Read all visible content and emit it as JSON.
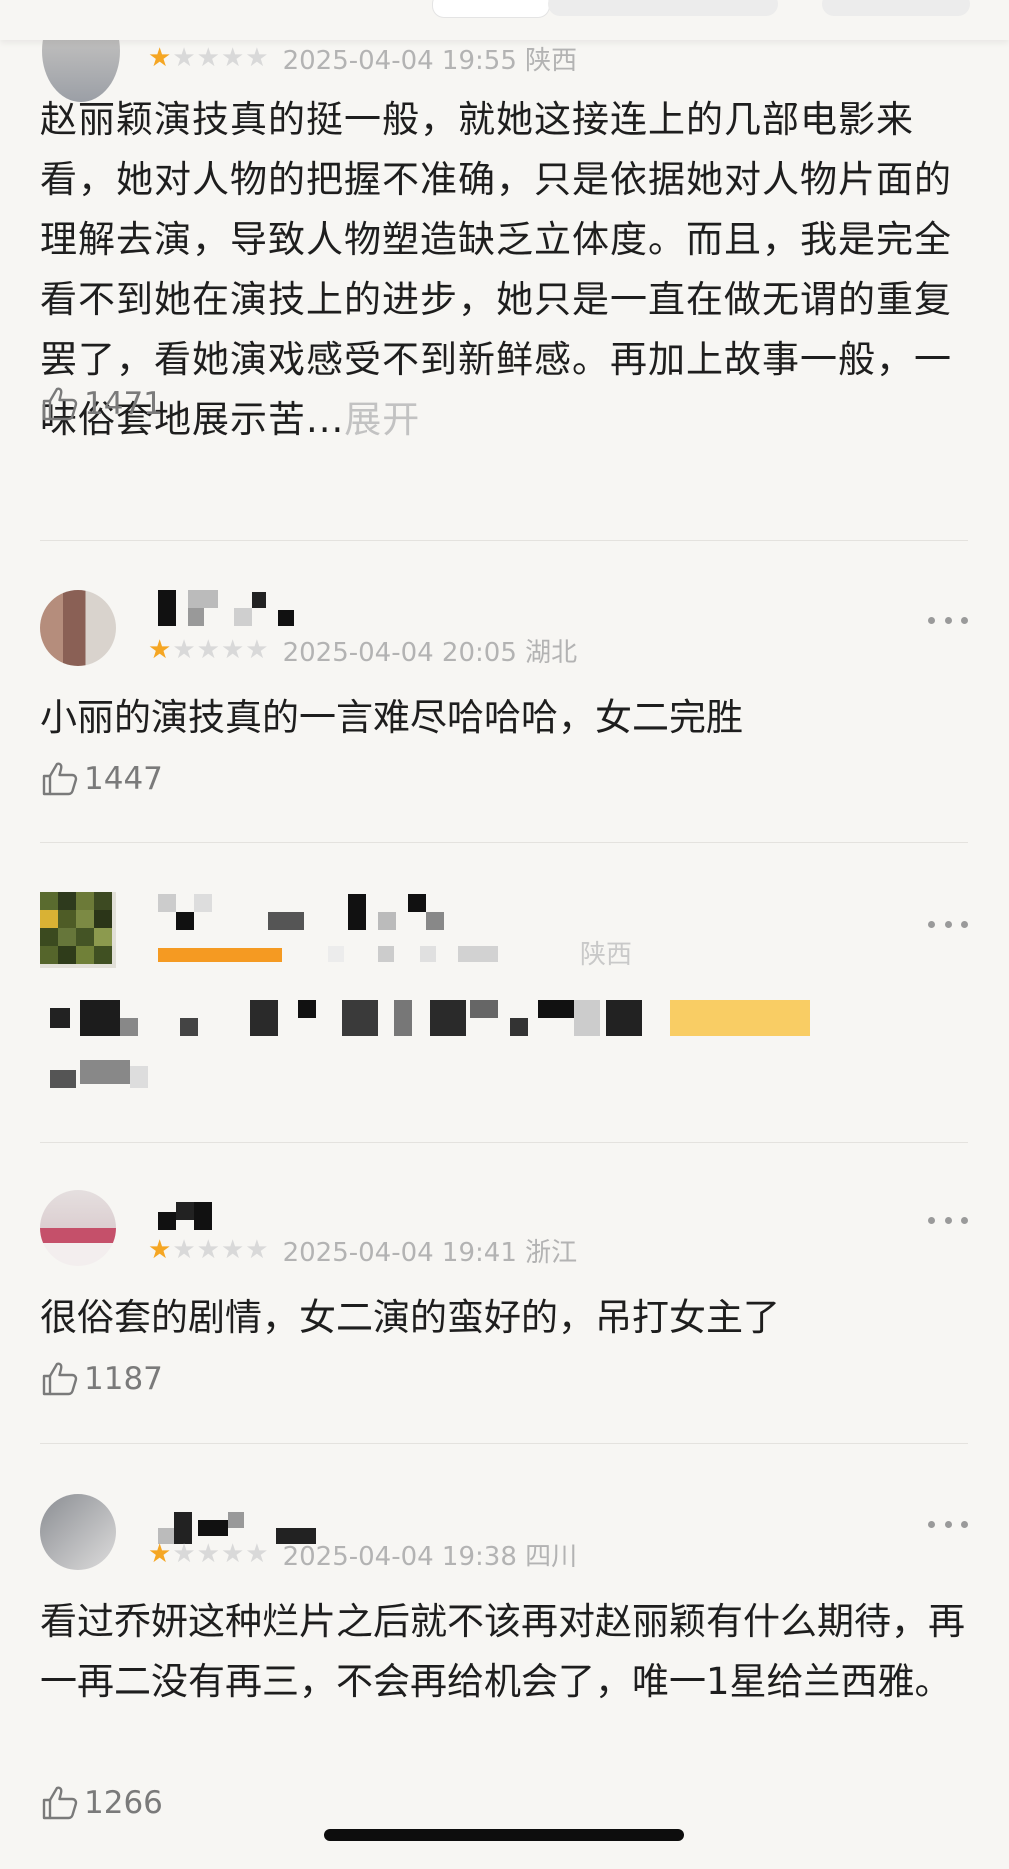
{
  "colors": {
    "accent_star": "#f5a623",
    "muted_text": "#b3b3b3",
    "background": "#f7f6f3"
  },
  "icons": {
    "like": "thumbs-up-icon",
    "more": "more-dots-icon",
    "star": "star-icon"
  },
  "reviews": [
    {
      "rating": 1,
      "date": "2025-04-04 19:55",
      "region": "陕西",
      "text": "赵丽颖演技真的挺一般，就她这接连上的几部电影来看，她对人物的把握不准确，只是依据她对人物片面的理解去演，导致人物塑造缺乏立体度。而且，我是完全看不到她在演技上的进步，她只是一直在做无谓的重复罢了，看她演戏感受不到新鲜感。再加上故事一般，一味俗套地展示苦...",
      "expand_label": "展开",
      "likes": "1471"
    },
    {
      "rating": 1,
      "date": "2025-04-04 20:05",
      "region": "湖北",
      "text": "小丽的演技真的一言难尽哈哈哈，女二完胜",
      "likes": "1447"
    },
    {
      "region": "陕西"
    },
    {
      "rating": 1,
      "date": "2025-04-04 19:41",
      "region": "浙江",
      "text": "很俗套的剧情，女二演的蛮好的，吊打女主了",
      "likes": "1187"
    },
    {
      "rating": 1,
      "date": "2025-04-04 19:38",
      "region": "四川",
      "text": "看过乔妍这种烂片之后就不该再对赵丽颖有什么期待，再一再二没有再三，不会再给机会了，唯一1星给兰西雅。",
      "likes": "1266"
    }
  ]
}
